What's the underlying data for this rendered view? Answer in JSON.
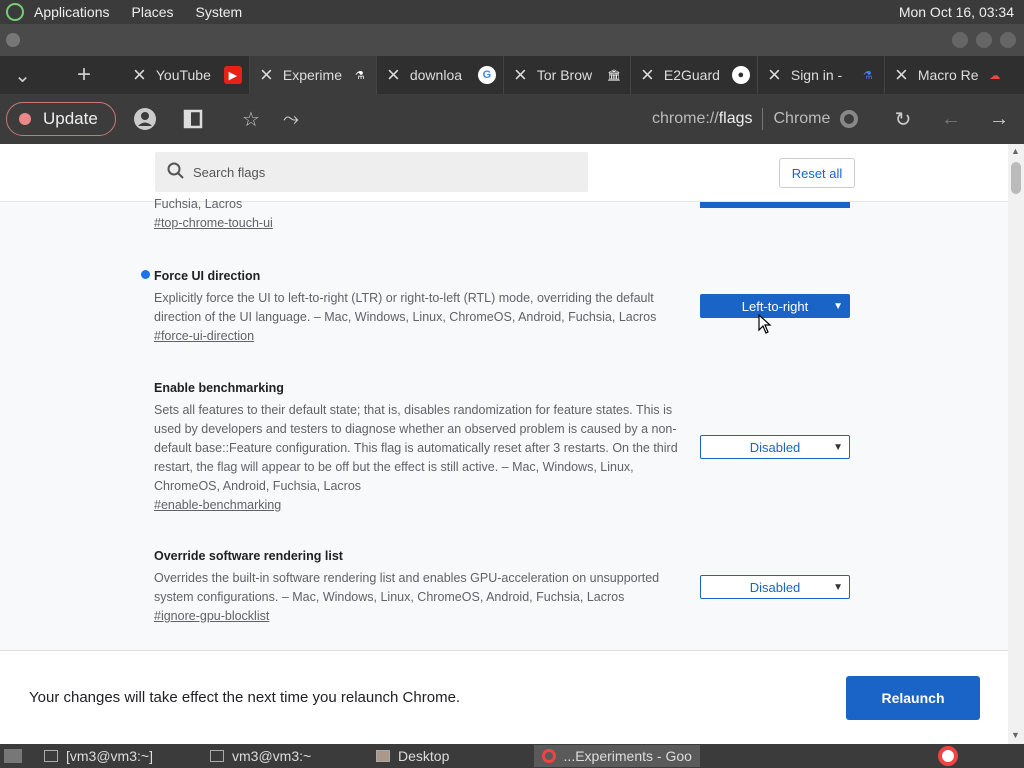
{
  "topbar": {
    "menus": [
      "Applications",
      "Places",
      "System"
    ],
    "clock": "Mon Oct 16, 03:34"
  },
  "tabs": [
    {
      "title": "YouTube",
      "fav_color": "#e62117",
      "fav_glyph": "▶"
    },
    {
      "title": "Experime",
      "fav_color": "#3c3c3c",
      "fav_glyph": "⚗",
      "active": true
    },
    {
      "title": "downloa",
      "fav_color": "#ffffff",
      "fav_glyph": "G"
    },
    {
      "title": "Tor Brow",
      "fav_color": "#2f2f2f",
      "fav_glyph": "🏛"
    },
    {
      "title": "E2Guard",
      "fav_color": "#ffffff",
      "fav_glyph": "●"
    },
    {
      "title": "Sign in -",
      "fav_color": "#2f2f2f",
      "fav_glyph": "⚗"
    },
    {
      "title": "Macro Re",
      "fav_color": "#2f2f2f",
      "fav_glyph": "☁"
    }
  ],
  "toolbar": {
    "update_label": "Update",
    "omnibox_prefix": "chrome://",
    "omnibox_path": "flags",
    "omnibox_site": "Chrome"
  },
  "search": {
    "placeholder": "Search flags"
  },
  "reset_label": "Reset all",
  "flags": [
    {
      "name": "",
      "desc": "Fuchsia, Lacros",
      "link": "#top-chrome-touch-ui"
    },
    {
      "name": "Force UI direction",
      "desc": "Explicitly force the UI to left-to-right (LTR) or right-to-left (RTL) mode, overriding the default direction of the UI language. – Mac, Windows, Linux, ChromeOS, Android, Fuchsia, Lacros",
      "link": "#force-ui-direction",
      "value": "Left-to-right",
      "modified": true
    },
    {
      "name": "Enable benchmarking",
      "desc": "Sets all features to their default state; that is, disables randomization for feature states. This is used by developers and testers to diagnose whether an observed problem is caused by a non-default base::Feature configuration. This flag is automatically reset after 3 restarts. On the third restart, the flag will appear to be off but the effect is still active. – Mac, Windows, Linux, ChromeOS, Android, Fuchsia, Lacros",
      "link": "#enable-benchmarking",
      "value": "Disabled"
    },
    {
      "name": "Override software rendering list",
      "desc": "Overrides the built-in software rendering list and enables GPU-acceleration on unsupported system configurations. – Mac, Windows, Linux, ChromeOS, Android, Fuchsia, Lacros",
      "link": "#ignore-gpu-blocklist",
      "value": "Disabled"
    }
  ],
  "footer": {
    "message": "Your changes will take effect the next time you relaunch Chrome.",
    "relaunch_label": "Relaunch"
  },
  "taskbar": [
    {
      "label": "[vm3@vm3:~]"
    },
    {
      "label": "vm3@vm3:~"
    },
    {
      "label": "Desktop"
    },
    {
      "label": "...Experiments - Goog",
      "active": true
    }
  ],
  "colors": {
    "accent": "#1a64c8",
    "modified_dot": "#1a73e8"
  }
}
